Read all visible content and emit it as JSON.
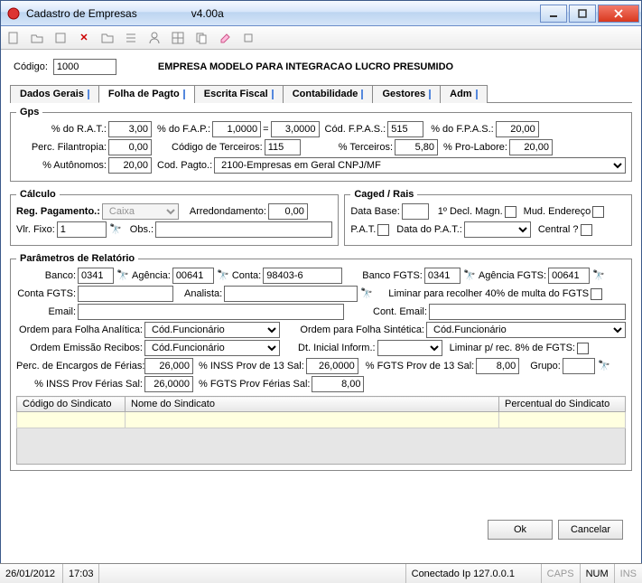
{
  "window": {
    "title": "Cadastro de Empresas",
    "version": "v4.00a"
  },
  "header": {
    "codigo_label": "Código:",
    "codigo": "1000",
    "company_name": "EMPRESA MODELO PARA INTEGRACAO LUCRO PRESUMIDO"
  },
  "tabs": [
    "Dados Gerais",
    "Folha de Pagto",
    "Escrita Fiscal",
    "Contabilidade",
    "Gestores",
    "Adm"
  ],
  "gps": {
    "legend": "Gps",
    "rat_label": "% do R.A.T.:",
    "rat": "3,00",
    "fap_label": "% do F.A.P.:",
    "fap": "1,0000",
    "eq": "=",
    "fap_result": "3,0000",
    "cod_fpas_label": "Cód. F.P.A.S.:",
    "cod_fpas": "515",
    "pc_fpas_label": "% do F.P.A.S.:",
    "pc_fpas": "20,00",
    "filantropia_label": "Perc. Filantropia:",
    "filantropia": "0,00",
    "cod_terceiros_label": "Código de Terceiros:",
    "cod_terceiros": "115",
    "pc_terceiros_label": "% Terceiros:",
    "pc_terceiros": "5,80",
    "pro_labore_label": "% Pro-Labore:",
    "pro_labore": "20,00",
    "autonomos_label": "% Autônomos:",
    "autonomos": "20,00",
    "cod_pagto_label": "Cod. Pagto.:",
    "cod_pagto": "2100-Empresas em Geral CNPJ/MF"
  },
  "calculo": {
    "legend": "Cálculo",
    "reg_pag_label": "Reg. Pagamento.:",
    "reg_pag": "Caixa",
    "arredond_label": "Arredondamento:",
    "arredond": "0,00",
    "vlr_fixo_label": "Vlr. Fixo:",
    "vlr_fixo": "1",
    "obs_label": "Obs.:",
    "obs": ""
  },
  "caged": {
    "legend": "Caged / Rais",
    "data_base_label": "Data Base:",
    "data_base": "",
    "decl_magn_label": "1º Decl. Magn.",
    "mud_end_label": "Mud. Endereço",
    "pat_label": "P.A.T.",
    "data_pat_label": "Data do P.A.T.:",
    "data_pat": "",
    "central_label": "Central ?"
  },
  "param": {
    "legend": "Parâmetros de Relatório",
    "banco_label": "Banco:",
    "banco": "0341",
    "agencia_label": "Agência:",
    "agencia": "00641",
    "conta_label": "Conta:",
    "conta": "98403-6",
    "banco_fgts_label": "Banco FGTS:",
    "banco_fgts": "0341",
    "agencia_fgts_label": "Agência FGTS:",
    "agencia_fgts": "00641",
    "conta_fgts_label": "Conta FGTS:",
    "conta_fgts": "",
    "analista_label": "Analista:",
    "analista": "",
    "liminar40_label": "Liminar para recolher 40% de multa do FGTS",
    "email_label": "Email:",
    "email": "",
    "cont_email_label": "Cont. Email:",
    "cont_email": "",
    "ordem_analitica_label": "Ordem para Folha Analítica:",
    "ordem_analitica": "Cód.Funcionário",
    "ordem_sintetica_label": "Ordem para Folha Sintética:",
    "ordem_sintetica": "Cód.Funcionário",
    "ordem_recibos_label": "Ordem Emissão Recibos:",
    "ordem_recibos": "Cód.Funcionário",
    "dt_inicial_label": "Dt. Inicial Inform.:",
    "dt_inicial": "",
    "liminar8_label": "Liminar p/ rec. 8% de FGTS:",
    "enc_ferias_label": "Perc. de Encargos de Férias:",
    "enc_ferias": "26,000",
    "inss_13_label": "% INSS Prov de 13 Sal:",
    "inss_13": "26,0000",
    "fgts_13_label": "% FGTS Prov de 13 Sal:",
    "fgts_13": "8,00",
    "grupo_label": "Grupo:",
    "grupo": "",
    "inss_ferias_label": "% INSS Prov Férias Sal:",
    "inss_ferias": "26,0000",
    "fgts_ferias_label": "% FGTS Prov Férias Sal:",
    "fgts_ferias": "8,00"
  },
  "sindicato_table": {
    "cols": [
      "Código do Sindicato",
      "Nome do Sindicato",
      "Percentual do Sindicato"
    ]
  },
  "buttons": {
    "ok": "Ok",
    "cancel": "Cancelar"
  },
  "status": {
    "date": "26/01/2012",
    "time": "17:03",
    "conn": "Conectado Ip 127.0.0.1",
    "caps": "CAPS",
    "num": "NUM",
    "ins": "INS"
  }
}
